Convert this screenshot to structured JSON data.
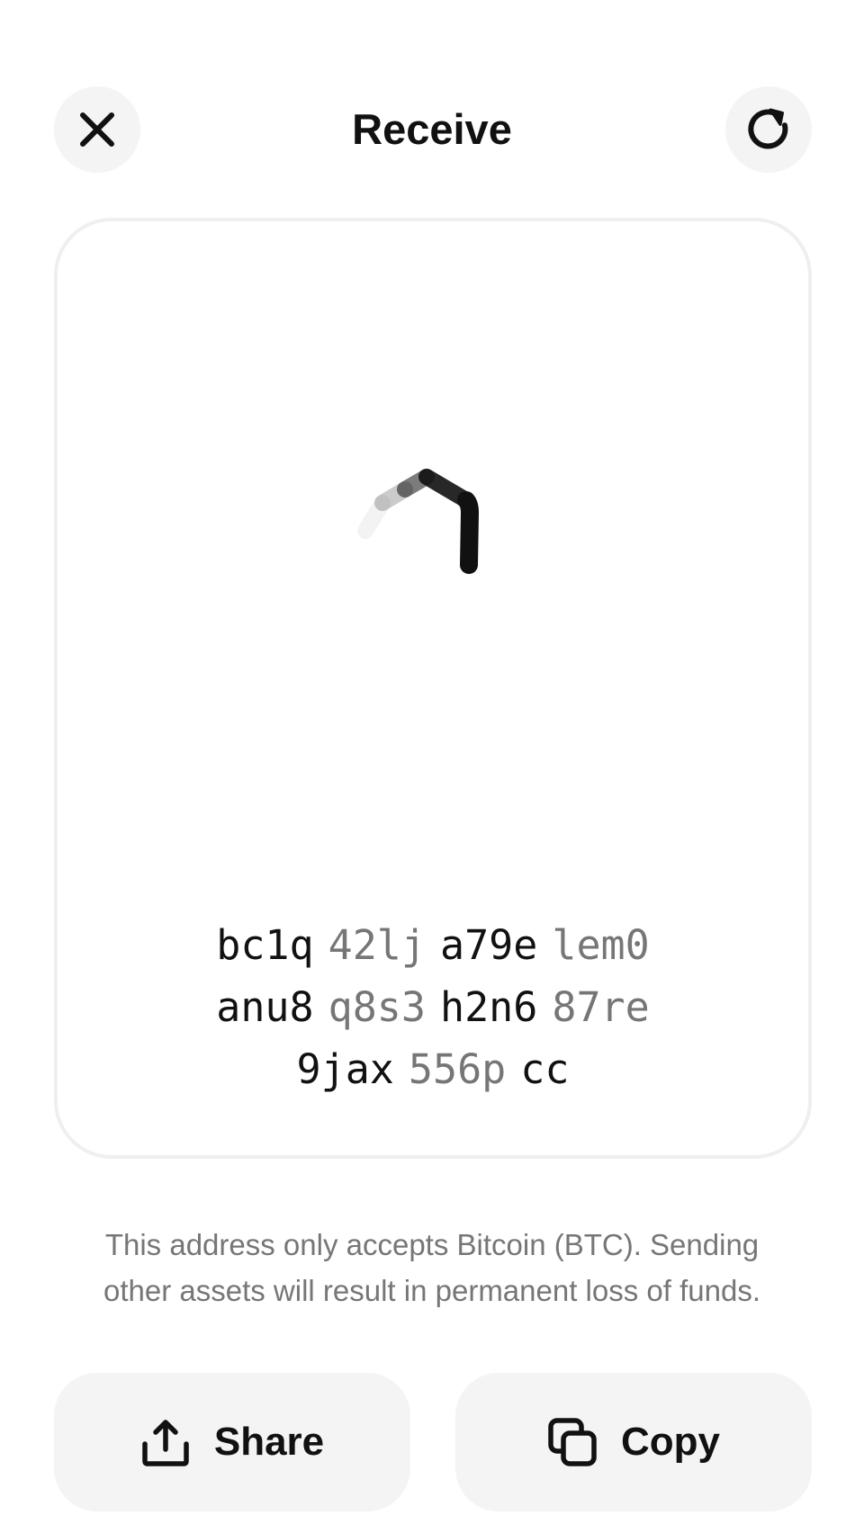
{
  "header": {
    "title": "Receive",
    "close_icon": "close-icon",
    "refresh_icon": "refresh-icon"
  },
  "address_card": {
    "loading_icon": "loading-spinner",
    "address_lines": [
      [
        "bc1q",
        "42lj",
        "a79e",
        "lem0"
      ],
      [
        "anu8",
        "q8s3",
        "h2n6",
        "87re"
      ],
      [
        "9jax",
        "556p",
        "cc"
      ]
    ]
  },
  "notice": {
    "line1": "This address only accepts Bitcoin (BTC). Sending",
    "line2": "other assets will result in permanent loss of funds."
  },
  "actions": {
    "share_label": "Share",
    "share_icon": "share-icon",
    "copy_label": "Copy",
    "copy_icon": "copy-icon"
  },
  "colors": {
    "primary_text": "#111111",
    "secondary_text": "#767676",
    "button_background": "#f4f4f4",
    "card_border": "#efefef"
  }
}
